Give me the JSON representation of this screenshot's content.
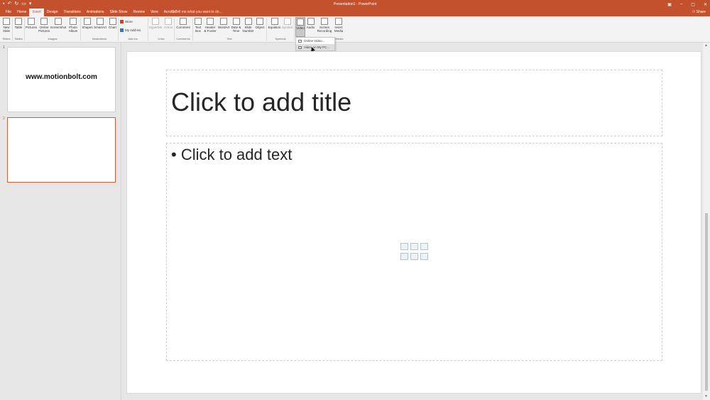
{
  "window": {
    "title": "Presentation1 - PowerPoint",
    "qat_icons": [
      "save-icon",
      "undo-icon",
      "redo-icon",
      "start-from-beginning-icon",
      "customize-icon"
    ],
    "controls": [
      "–",
      "▢",
      "✕"
    ]
  },
  "tabs": [
    "File",
    "Home",
    "Insert",
    "Design",
    "Transitions",
    "Animations",
    "Slide Show",
    "Review",
    "View",
    "Acrobat"
  ],
  "active_tab": "Insert",
  "tellme": "Tell me what you want to do...",
  "share": "Share",
  "ribbon": {
    "buttons": {
      "new_slide": "New\nSlide",
      "table": "Table",
      "pictures": "Pictures",
      "online_pictures": "Online\nPictures",
      "screenshot": "Screenshot",
      "photo_album": "Photo\nAlbum",
      "shapes": "Shapes",
      "smartart": "SmartArt",
      "chart": "Chart",
      "store": "Store",
      "my_addins": "My Add-ins",
      "hyperlink": "Hyperlink",
      "action": "Action",
      "comment": "Comment",
      "text_box": "Text\nBox",
      "header_footer": "Header\n& Footer",
      "wordart": "WordArt",
      "date_time": "Date &\nTime",
      "slide_number": "Slide\nNumber",
      "object": "Object",
      "equation": "Equation",
      "symbol": "Symbol",
      "video": "Video",
      "audio": "Audio",
      "screen_recording": "Screen\nRecording",
      "insert_media": "Insert\nMedia"
    },
    "groups": {
      "slides": "Slides",
      "tables": "Tables",
      "images": "Images",
      "illustrations": "Illustrations",
      "addins": "Add-ins",
      "links": "Links",
      "comments": "Comments",
      "text": "Text",
      "symbols": "Symbols",
      "media": "Media"
    }
  },
  "video_menu": {
    "online": "Online Video...",
    "mypc": "Video on My PC..."
  },
  "thumbnails": [
    {
      "num": "1",
      "text": "www.motionbolt.com"
    },
    {
      "num": "2",
      "text": ""
    }
  ],
  "slide": {
    "title_placeholder": "Click to add title",
    "body_placeholder": "• Click to add text"
  },
  "colors": {
    "accent": "#c4512d",
    "ribbon_bg": "#f3f3f3",
    "workspace_bg": "#e6e6e6"
  }
}
